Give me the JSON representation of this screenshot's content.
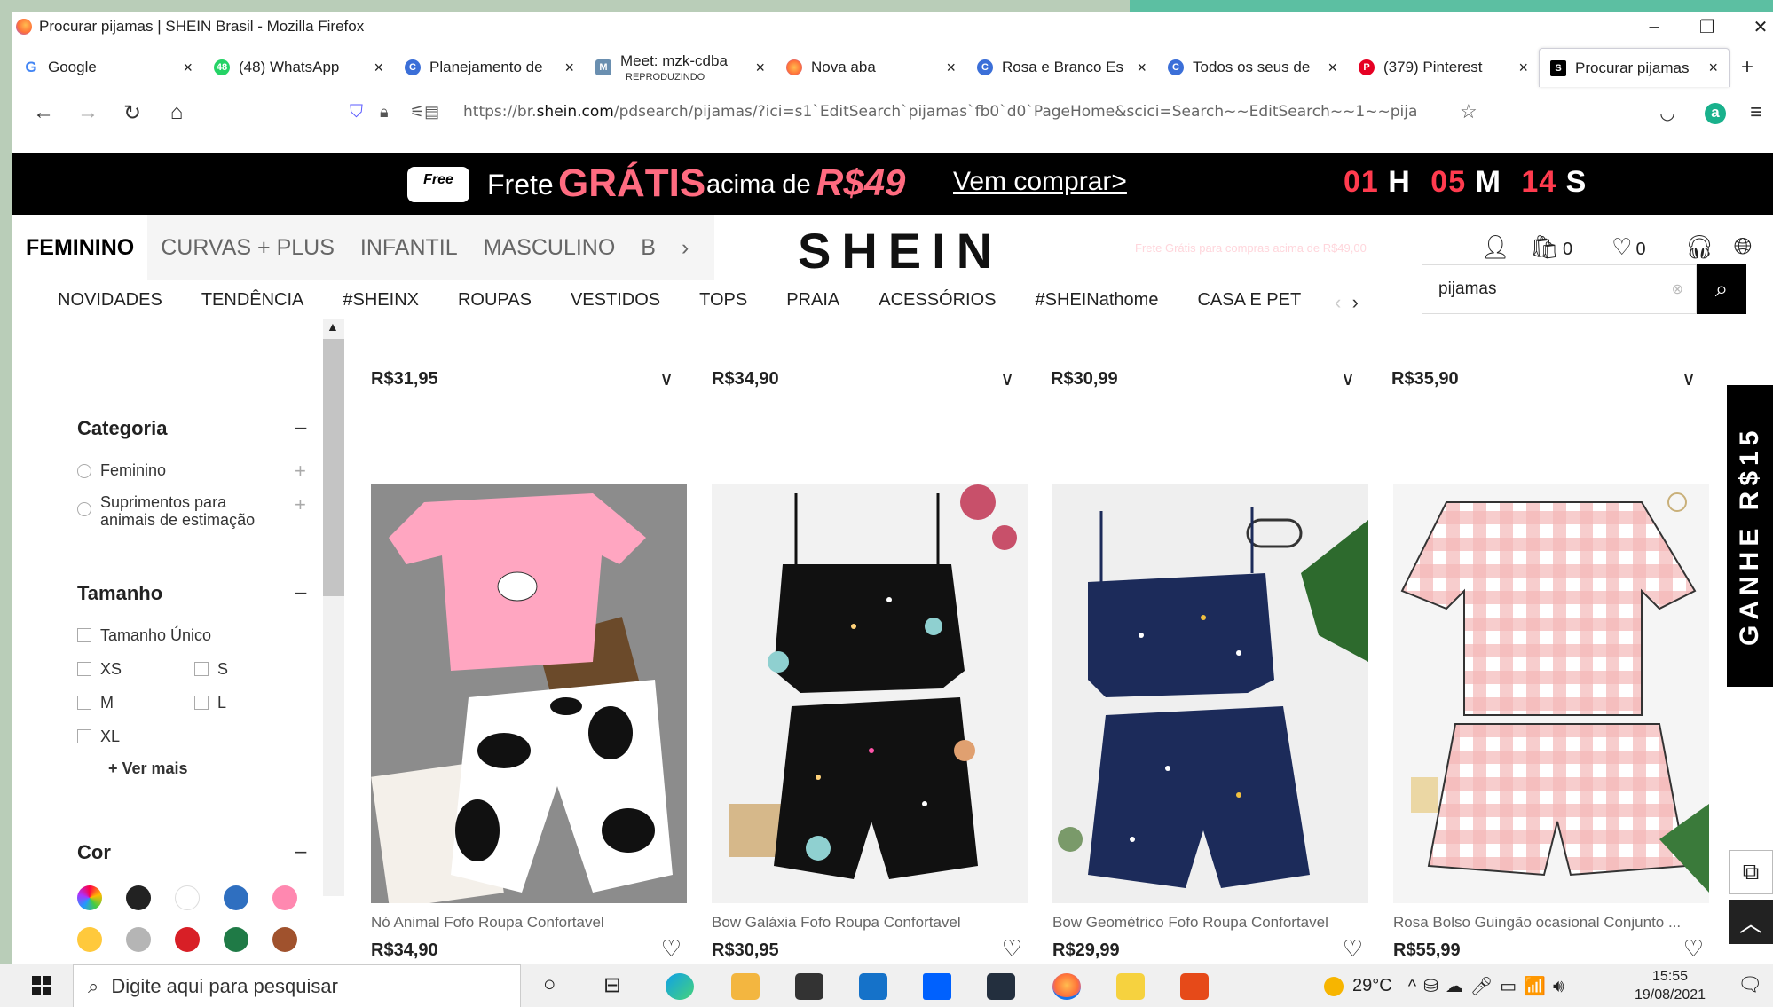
{
  "window": {
    "title": "Procurar pijamas | SHEIN Brasil - Mozilla Firefox",
    "minimize": "–",
    "restore": "❐",
    "close": "✕"
  },
  "tabs": [
    {
      "label": "Google",
      "icon": "G",
      "color": "#4285f4"
    },
    {
      "label": "(48) WhatsApp",
      "icon": "48",
      "color": "#25d366"
    },
    {
      "label": "Planejamento de",
      "icon": "C",
      "color": "#3b6fd8"
    },
    {
      "label": "Meet: mzk-cdba",
      "sub": "REPRODUZINDO",
      "icon": "M",
      "color": "#6a8fb0"
    },
    {
      "label": "Nova aba",
      "icon": "",
      "color": "#ff7139"
    },
    {
      "label": "Rosa e Branco Es",
      "icon": "C",
      "color": "#3b6fd8"
    },
    {
      "label": "Todos os seus de",
      "icon": "C",
      "color": "#3b6fd8"
    },
    {
      "label": "(379) Pinterest",
      "icon": "P",
      "color": "#e60023"
    },
    {
      "label": "Procurar pijamas",
      "icon": "S",
      "color": "#000"
    }
  ],
  "tab_close": "×",
  "new_tab": "+",
  "url": {
    "prefix": "https://br.",
    "domain": "shein.com",
    "rest": "/pdsearch/pijamas/?ici=s1`EditSearch`pijamas`fb0`d0`PageHome&scici=Search~~EditSearch~~1~~pija"
  },
  "promo": {
    "free": "Free",
    "frete": "Frete",
    "gratis": "GRÁTIS",
    "acima": "acima de",
    "price": "R$49",
    "cta": "Vem comprar>",
    "h": "01",
    "h_label": "H",
    "m": "05",
    "m_label": "M",
    "s": "14",
    "s_label": "S"
  },
  "header": {
    "categories": [
      "FEMININO",
      "CURVAS + PLUS",
      "INFANTIL",
      "MASCULINO",
      "B"
    ],
    "logo": "SHEIN",
    "free_shipping_note": "Frete Grátis para compras acima de R$49,00",
    "bag_count": "0",
    "wish_count": "0",
    "menu": [
      "NOVIDADES",
      "TENDÊNCIA",
      "#SHEINX",
      "ROUPAS",
      "VESTIDOS",
      "TOPS",
      "PRAIA",
      "ACESSÓRIOS",
      "#SHEINathome",
      "CASA E PET"
    ],
    "search_value": "pijamas"
  },
  "sidebar": {
    "categoria": "Categoria",
    "categoria_opts": [
      "Feminino",
      "Suprimentos para animais de estimação"
    ],
    "tamanho": "Tamanho",
    "tam_unico": "Tamanho Único",
    "sizes": [
      "XS",
      "S",
      "M",
      "L",
      "XL"
    ],
    "ver_mais": "+ Ver mais",
    "cor": "Cor",
    "colors": [
      "#f2a33a",
      "#222222",
      "#ffffff",
      "#2f6fc0",
      "#ff88b0",
      "#ffc93c",
      "#b5b5b5",
      "#d81f26",
      "#1f7a46",
      "#a0522d"
    ]
  },
  "cut_prices": [
    "R$31,95",
    "R$34,90",
    "R$30,99",
    "R$35,90"
  ],
  "products": [
    {
      "title": "Nó Animal Fofo Roupa Confortavel",
      "price": "R$34,90"
    },
    {
      "title": "Bow Galáxia Fofo Roupa Confortavel",
      "price": "R$30,95"
    },
    {
      "title": "Bow Geométrico Fofo Roupa Confortavel",
      "price": "R$29,99"
    },
    {
      "title": "Rosa Bolso Guingão ocasional Conjunto ...",
      "price": "R$55,99"
    }
  ],
  "side_promo": "GANHE R$15",
  "taskbar": {
    "search_placeholder": "Digite aqui para pesquisar",
    "weather": "29°C",
    "time": "15:55",
    "date": "19/08/2021"
  }
}
